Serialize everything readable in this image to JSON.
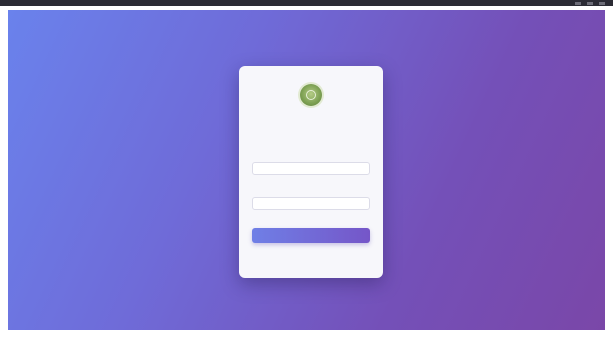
{
  "window": {
    "controls": [
      "minimize-icon",
      "maximize-icon",
      "close-icon"
    ]
  },
  "background": {
    "gradient": [
      "#6a82ec",
      "#6f6bd8",
      "#7450b8",
      "#7a47a8"
    ]
  },
  "login": {
    "logo_icon": "emblem-seal-icon",
    "title": "",
    "subtitle": "",
    "username_label": "",
    "username_value": "",
    "password_label": "",
    "password_placeholder": "",
    "submit_label": "",
    "footer_note": ""
  },
  "colors": {
    "accent": "#7556c8",
    "card": "#f7f7fb",
    "title": "#2e3a6e"
  }
}
